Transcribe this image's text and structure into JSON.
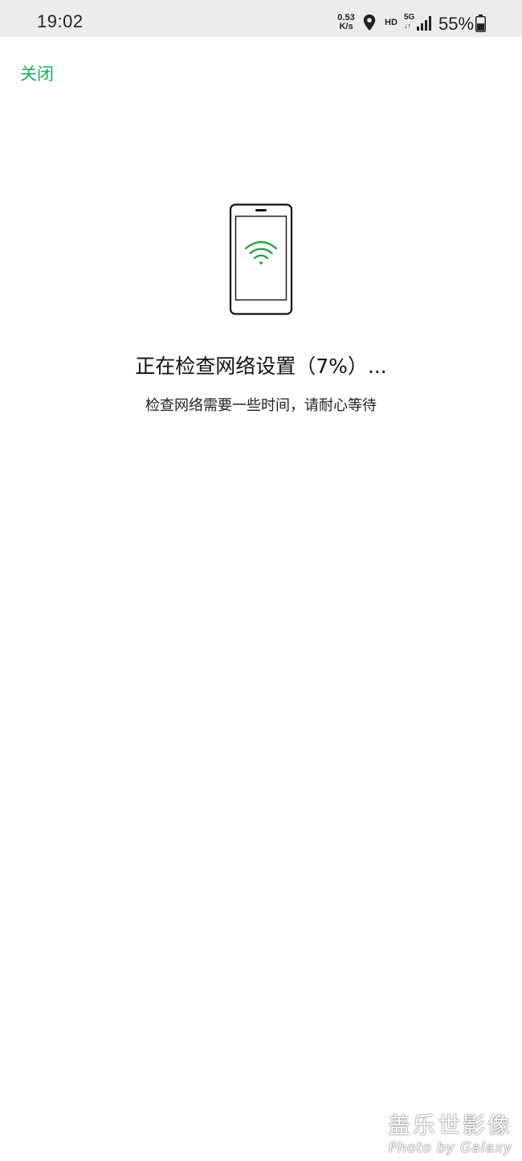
{
  "status_bar": {
    "time": "19:02",
    "net_speed_value": "0.53",
    "net_speed_unit": "K/s",
    "location_icon": "location-pin-icon",
    "hd_label": "HD",
    "network_type": "5G",
    "network_arrows": "↓↑",
    "signal_icon": "signal-bars-icon",
    "battery_text": "55%",
    "battery_icon": "battery-icon",
    "battery_level": 0.55
  },
  "header": {
    "close_label": "关闭"
  },
  "main": {
    "illustration_icon": "phone-wifi-icon",
    "title": "正在检查网络设置（7%）...",
    "subtitle": "检查网络需要一些时间，请耐心等待"
  },
  "watermark": {
    "line1": "盖乐世影像",
    "line2": "Photo by Galaxy"
  },
  "colors": {
    "accent": "#1aad5f",
    "wifi": "#1e9e3a",
    "status_bar_bg": "#ececec",
    "text": "#111111"
  }
}
